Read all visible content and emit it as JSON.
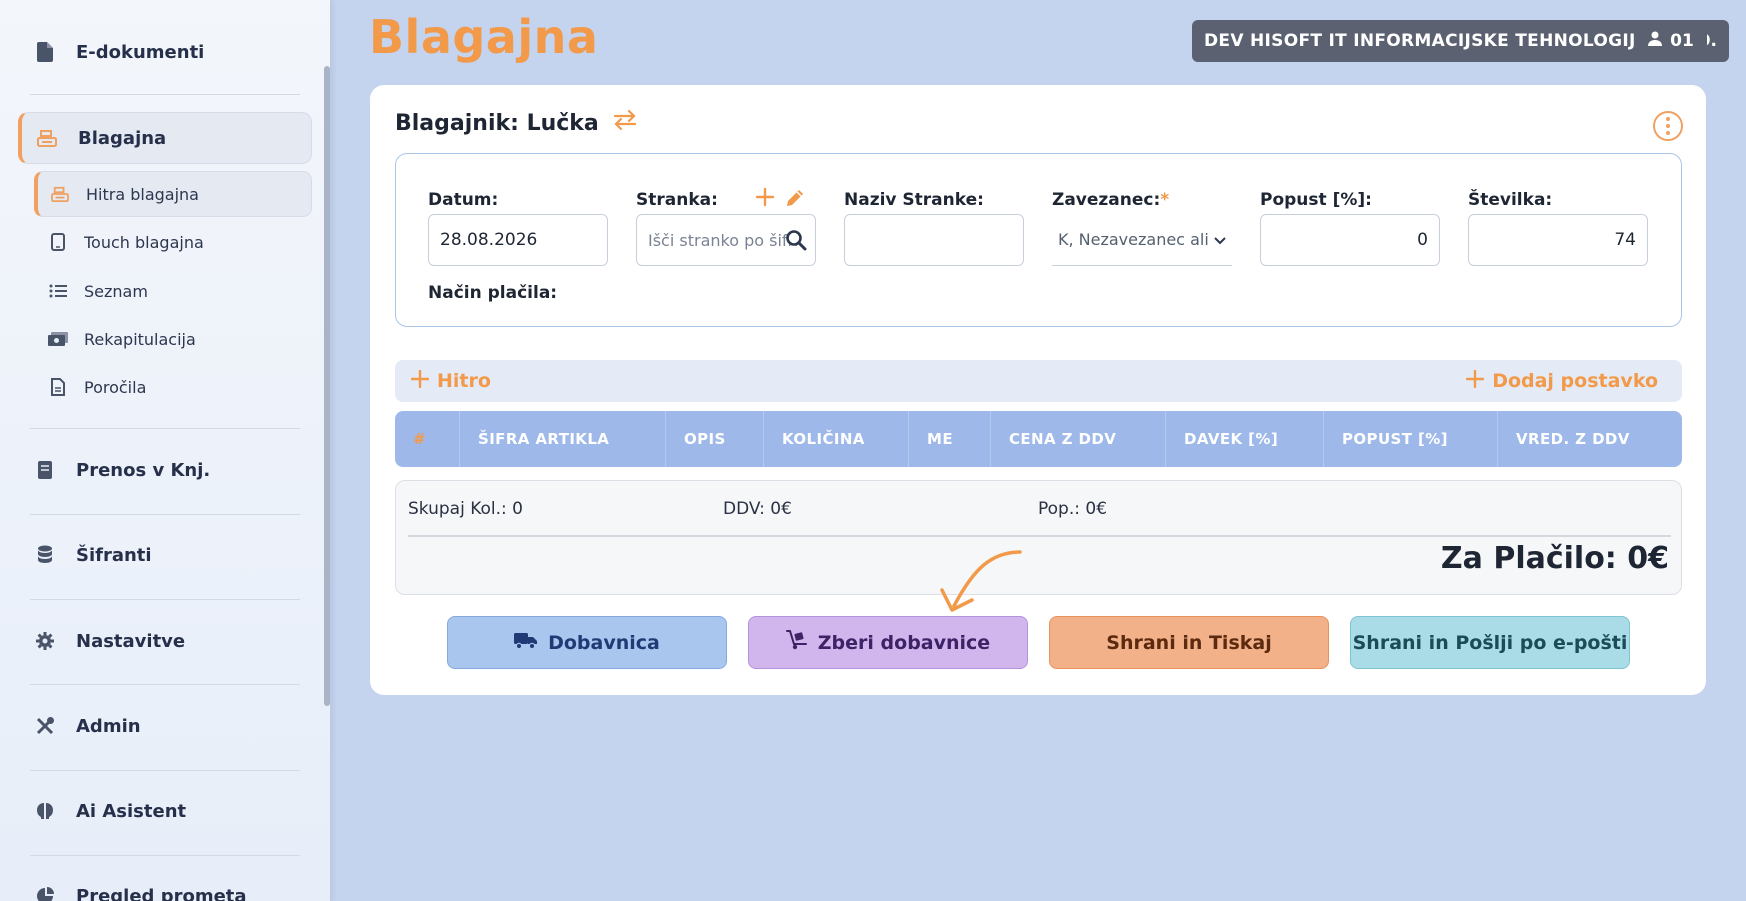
{
  "sidebar": {
    "items": [
      {
        "label": "E-dokumenti",
        "icon": "document-icon"
      },
      {
        "label": "Blagajna",
        "icon": "cash-register-icon",
        "active": true
      },
      {
        "label": "Prenos v Knj.",
        "icon": "book-icon"
      },
      {
        "label": "Šifranti",
        "icon": "database-icon"
      },
      {
        "label": "Nastavitve",
        "icon": "gear-icon"
      },
      {
        "label": "Admin",
        "icon": "tools-icon"
      },
      {
        "label": "Ai Asistent",
        "icon": "brain-icon"
      },
      {
        "label": "Pregled prometa",
        "icon": "chart-pie-icon"
      }
    ],
    "subitems": [
      {
        "label": "Hitra blagajna",
        "icon": "cash-register-icon",
        "active": true
      },
      {
        "label": "Touch blagajna",
        "icon": "tablet-icon"
      },
      {
        "label": "Seznam",
        "icon": "list-icon"
      },
      {
        "label": "Rekapitulacija",
        "icon": "money-icon"
      },
      {
        "label": "Poročila",
        "icon": "report-icon"
      }
    ]
  },
  "header": {
    "title": "Blagajna",
    "company": "DEV HISOFT IT INFORMACIJSKE TEHNOLOGIJE D.O.O.",
    "user": "01"
  },
  "card": {
    "cashier": "Blagajnik: Lučka",
    "form": {
      "date_label": "Datum:",
      "date_value": "28.08.2026",
      "client_label": "Stranka:",
      "client_placeholder": "Išči stranko po šifri",
      "client_name_label": "Naziv Stranke:",
      "client_name_value": "",
      "taxpayer_label": "Zavezanec:",
      "taxpayer_required": "*",
      "taxpayer_value": "K, Nezavezanec ali",
      "discount_label": "Popust [%]:",
      "discount_value": "0",
      "number_label": "Številka:",
      "number_value": "74",
      "payment_label": "Način plačila:"
    },
    "quick_label": "Hitro",
    "add_item_label": "Dodaj postavko",
    "table_headers": [
      "#",
      "ŠIFRA ARTIKLA",
      "OPIS",
      "KOLIČINA",
      "ME",
      "CENA Z DDV",
      "DAVEK [%]",
      "POPUST [%]",
      "VRED. Z DDV"
    ],
    "totals": {
      "qty": "Skupaj Kol.: 0",
      "vat": "DDV: 0€",
      "discount": "Pop.: 0€",
      "to_pay": "Za Plačilo: 0€"
    },
    "buttons": {
      "delivery": "Dobavnica",
      "collect": "Zberi dobavnice",
      "save_print": "Shrani in Tiskaj",
      "save_email": "Shrani in Pošlji po e-pošti"
    }
  },
  "colors": {
    "accent": "#f29a4a",
    "background": "#c4d3ee",
    "table_header": "#9db8e9"
  }
}
